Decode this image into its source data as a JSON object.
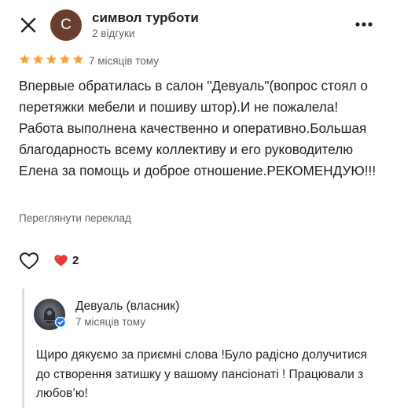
{
  "header": {
    "close_icon": "close-icon",
    "avatar_letter": "С",
    "avatar_color": "#6b3d2e",
    "user_name": "символ турботи",
    "reviews_count": "2 відгуки",
    "more_icon": "more-vert-icon"
  },
  "review": {
    "rating": 5,
    "star_color": "#f7a33b",
    "time": "7 місяців тому",
    "text": "Впервые обратилась в салон \"Девуаль\"(вопрос стоял о перетяжки мебели и пошиву штор).И не пожалела!Работа выполнена качественно и оперативно.Большая благодарность всему коллективу и его руководителю Елена за помощь и доброе отношение.РЕКОМЕНДУЮ!!!",
    "translate_label": "Переглянути переклад"
  },
  "reactions": {
    "like_icon": "heart-outline-icon",
    "reaction_icon": "red-heart-icon",
    "reaction_count": "2"
  },
  "owner_reply": {
    "owner_name": "Девуаль (власник)",
    "verified_icon": "verified-check-icon",
    "time": "7 місяців тому",
    "text": "Щиро дякуємо за приємні слова !Було радісно долучитися до створення затишку у вашому пансіонаті ! Працювали з любов’ю!"
  }
}
